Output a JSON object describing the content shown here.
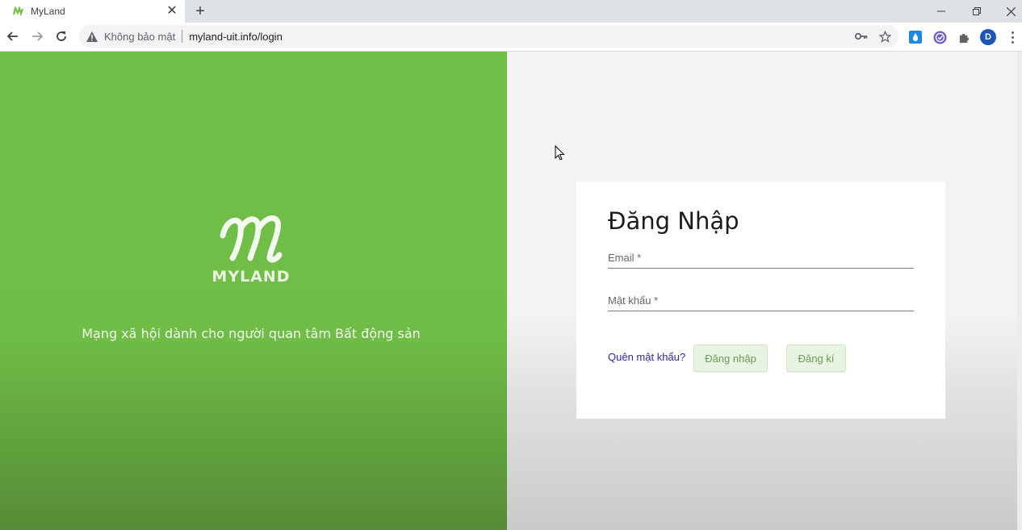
{
  "browser": {
    "tab_title": "MyLand",
    "insecure_label": "Không bảo mật",
    "url": "myland-uit.info/login",
    "profile_initial": "D"
  },
  "branding": {
    "logo_text": "MYLAND",
    "tagline": "Mạng xã hội dành cho người quan tâm Bất động sản"
  },
  "login": {
    "title": "Đăng Nhập",
    "email_label": "Email *",
    "password_label": "Mật khẩu *",
    "forgot_label": "Quên mật khẩu?",
    "login_button": "Đăng nhập",
    "register_button": "Đăng kí"
  },
  "colors": {
    "brand_green": "#72c04a",
    "link_blue": "#2a2aa8"
  },
  "icons": [
    "back-arrow-icon",
    "forward-arrow-icon",
    "reload-icon",
    "warning-icon",
    "key-icon",
    "star-icon",
    "puzzle-icon",
    "kebab-menu-icon"
  ]
}
